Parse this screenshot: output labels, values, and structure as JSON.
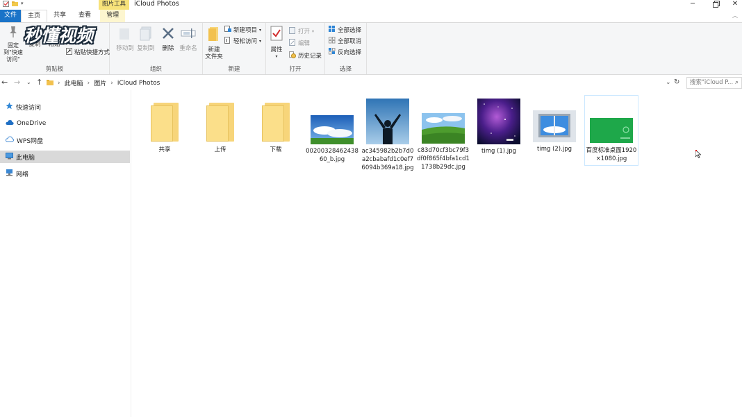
{
  "window": {
    "title": "iCloud Photos",
    "context_tab_group": "图片工具"
  },
  "ribbon_tabs": [
    "文件",
    "主页",
    "共享",
    "查看",
    "管理"
  ],
  "logo_text": "秒懂视频",
  "ribbon": {
    "clipboard": {
      "label": "剪贴板",
      "pin": "固定到\"快速访问\"",
      "copy": "复制",
      "paste": "粘贴",
      "cut": "剪切",
      "paste_shortcut": "粘贴快捷方式"
    },
    "organize": {
      "label": "组织",
      "move_to": "移动到",
      "copy_to": "复制到",
      "delete": "删除",
      "rename": "重命名"
    },
    "new": {
      "label": "新建",
      "new_folder_line1": "新建",
      "new_folder_line2": "文件夹",
      "new_item": "新建项目",
      "easy_access": "轻松访问"
    },
    "open": {
      "label": "打开",
      "properties": "属性",
      "open": "打开",
      "edit": "编辑",
      "history": "历史记录"
    },
    "select": {
      "label": "选择",
      "select_all": "全部选择",
      "select_none": "全部取消",
      "invert": "反向选择"
    }
  },
  "breadcrumb": [
    "此电脑",
    "图片",
    "iCloud Photos"
  ],
  "search_placeholder": "搜索\"iCloud P...",
  "sidebar": [
    {
      "label": "快速访问",
      "icon": "star-icon",
      "selected": false
    },
    {
      "label": "OneDrive",
      "icon": "cloud-icon",
      "selected": false
    },
    {
      "label": "WPS网盘",
      "icon": "cloud-outline-icon",
      "selected": false
    },
    {
      "label": "此电脑",
      "icon": "computer-icon",
      "selected": true
    },
    {
      "label": "网络",
      "icon": "network-icon",
      "selected": false
    }
  ],
  "files": [
    {
      "name": "共享",
      "type": "folder"
    },
    {
      "name": "上传",
      "type": "folder"
    },
    {
      "name": "下载",
      "type": "folder"
    },
    {
      "name": "0020032846243860_b.jpg",
      "type": "image",
      "icon": "sky-clouds-thumbnail"
    },
    {
      "name": "ac345982b2b7d0a2cbabafd1c0ef76094b369a18.jpg",
      "type": "image",
      "icon": "person-sky-thumbnail"
    },
    {
      "name": "c83d70cf3bc79f3df0f865f4bfa1cd11738b29dc.jpg",
      "type": "image",
      "icon": "green-field-thumbnail"
    },
    {
      "name": "timg (1).jpg",
      "type": "image",
      "icon": "galaxy-thumbnail"
    },
    {
      "name": "timg (2).jpg",
      "type": "image",
      "icon": "window-sky-thumbnail"
    },
    {
      "name": "百度标准桌面1920×1080.jpg",
      "type": "image",
      "icon": "green-desktop-thumbnail",
      "selected": true
    }
  ]
}
